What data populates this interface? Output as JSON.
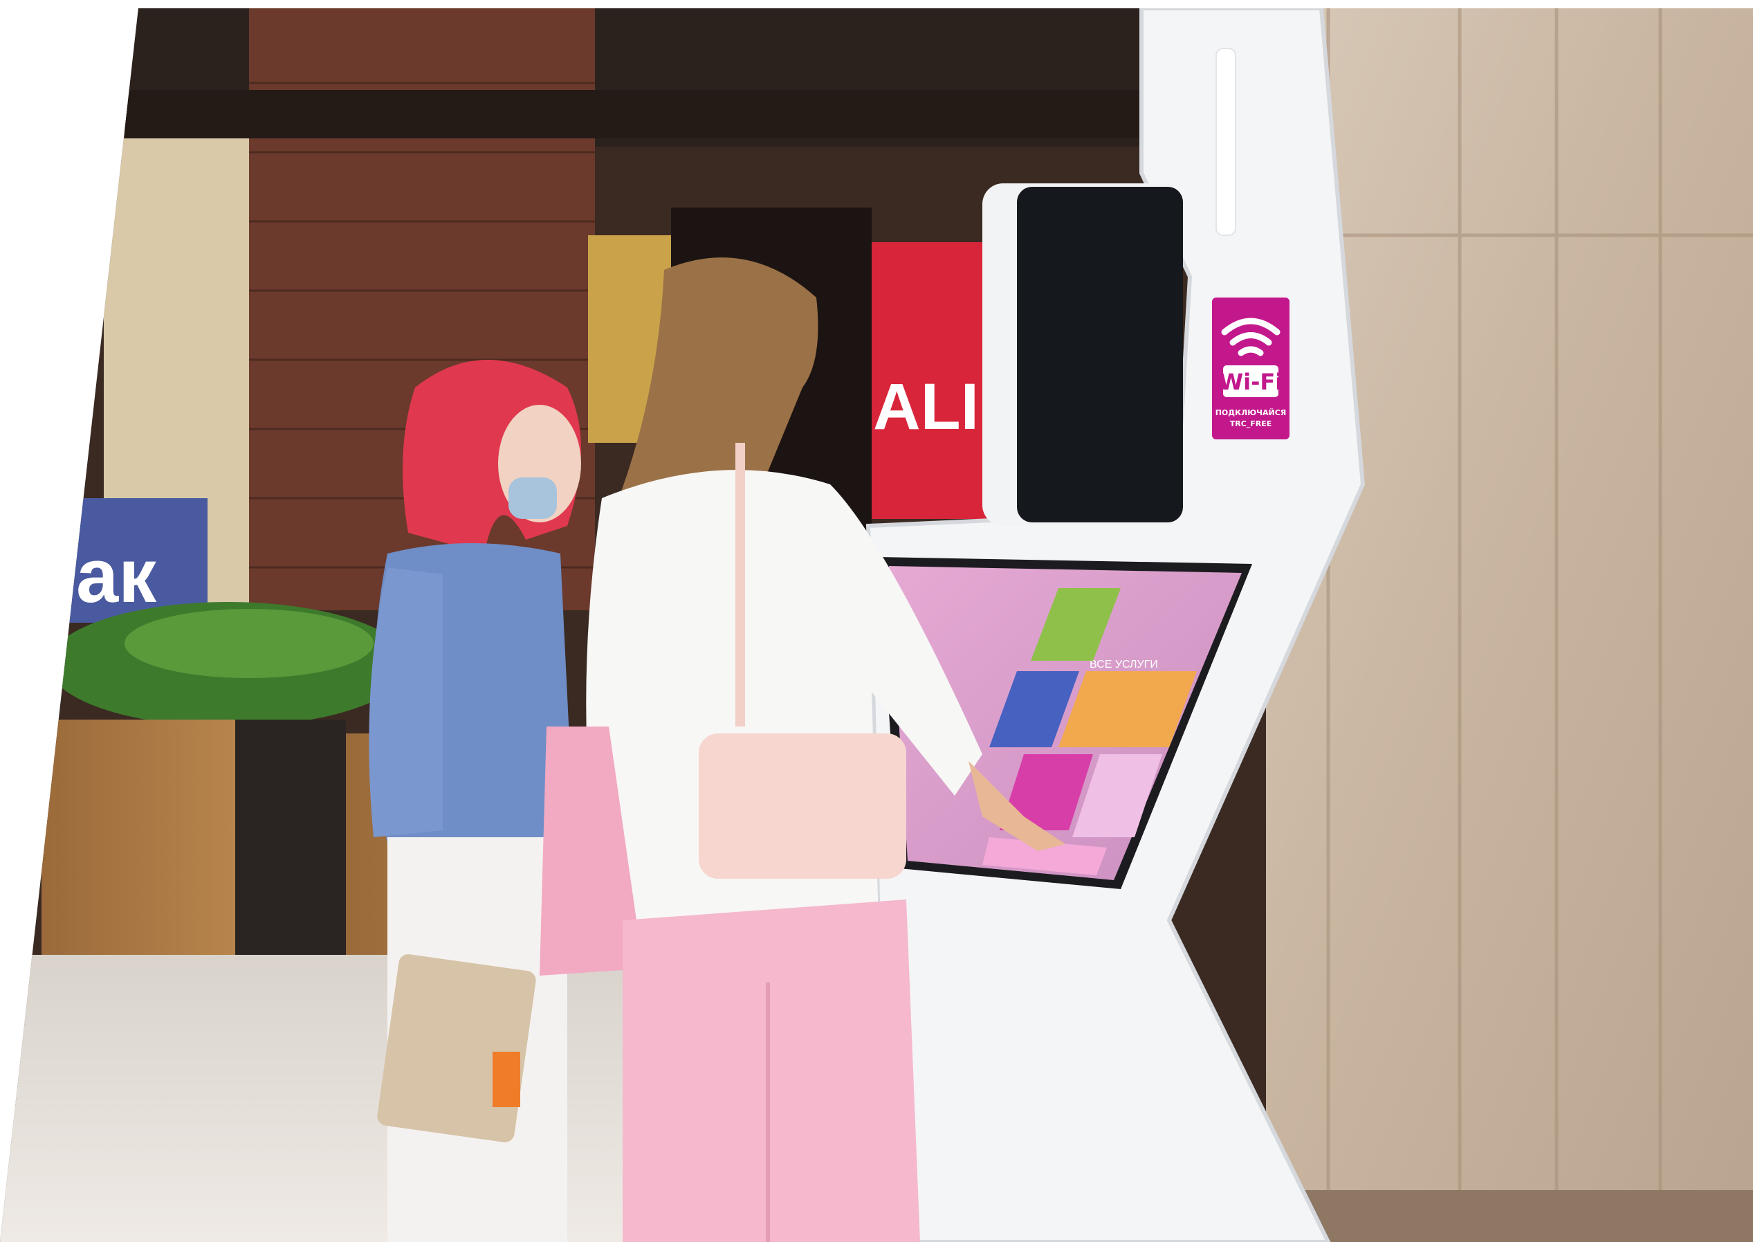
{
  "photo": {
    "description_free": true,
    "wifi_sign": {
      "label": "Wi-Fi",
      "line1": "ПОДКЛЮЧАЙСЯ",
      "line2": "TRC_FREE",
      "color": "#c2188c"
    },
    "store_sign": {
      "text": "ак"
    },
    "window_sign": {
      "text": "ALI"
    },
    "kiosk_screen": {
      "header": "ВСЕ УСЛУГИ",
      "tile_colors": [
        "#8fc04a",
        "#f2a94e",
        "#f4a9d8",
        "#4661c0",
        "#d83ea8",
        "#f0bfe6"
      ]
    },
    "colors": {
      "kiosk": "#f4f5f6",
      "marble": "#cbb8a4",
      "brick": "#6b3a2c",
      "pants": "#f5b8cc",
      "hair_red": "#e0384f",
      "hair_blonde": "#9b7147",
      "shirt_blue": "#6f8dc6"
    }
  }
}
